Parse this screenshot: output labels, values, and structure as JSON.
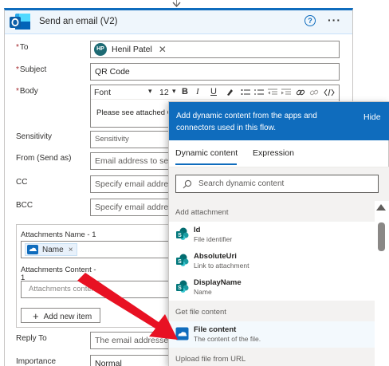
{
  "card": {
    "title": "Send an email (V2)",
    "help_glyph": "?",
    "more_glyph": "···"
  },
  "fields": {
    "to": {
      "label": "To",
      "required": "*",
      "avatar_initials": "HP",
      "recipient": "Henil Patel",
      "remove_glyph": "✕"
    },
    "subject": {
      "label": "Subject",
      "required": "*",
      "value": "QR Code"
    },
    "body": {
      "label": "Body",
      "required": "*",
      "font": "Font",
      "size": "12",
      "bold": "B",
      "italic": "I",
      "underline": "U",
      "text": "Please see attached QR"
    },
    "sensitivity": {
      "label": "Sensitivity",
      "placeholder": "Sensitivity"
    },
    "from": {
      "label": "From (Send as)",
      "placeholder": "Email address to send"
    },
    "cc": {
      "label": "CC",
      "placeholder": "Specify email address"
    },
    "bcc": {
      "label": "BCC",
      "placeholder": "Specify email addre"
    },
    "attachments": {
      "name_label": "Attachments Name - 1",
      "name_token": "Name",
      "token_remove": "×",
      "content_label": "Attachments Content - 1",
      "content_placeholder": "Attachments content",
      "add_button": "Add new item",
      "add_plus": "+"
    },
    "reply_to": {
      "label": "Reply To",
      "placeholder": "The email addresses"
    },
    "importance": {
      "label": "Importance",
      "value": "Normal"
    }
  },
  "dynamic_panel": {
    "header_text": "Add dynamic content from the apps and connectors used in this flow.",
    "hide_label": "Hide",
    "tabs": [
      "Dynamic content",
      "Expression"
    ],
    "active_tab": "Dynamic content",
    "search_placeholder": "Search dynamic content",
    "sections": [
      {
        "title": "Add attachment",
        "items": [
          {
            "title": "Id",
            "desc": "File identifier",
            "icon": "sharepoint-icon"
          },
          {
            "title": "AbsoluteUri",
            "desc": "Link to attachment",
            "icon": "sharepoint-icon"
          },
          {
            "title": "DisplayName",
            "desc": "Name",
            "icon": "sharepoint-icon"
          }
        ]
      },
      {
        "title": "Get file content",
        "items": [
          {
            "title": "File content",
            "desc": "The content of the file.",
            "icon": "onedrive-icon"
          }
        ]
      },
      {
        "title": "Upload file from URL",
        "items": []
      }
    ]
  },
  "colors": {
    "accent": "#0f6cbd",
    "required": "#a4262c",
    "annotation_arrow": "#e81123",
    "avatar": "#1d6a73"
  }
}
